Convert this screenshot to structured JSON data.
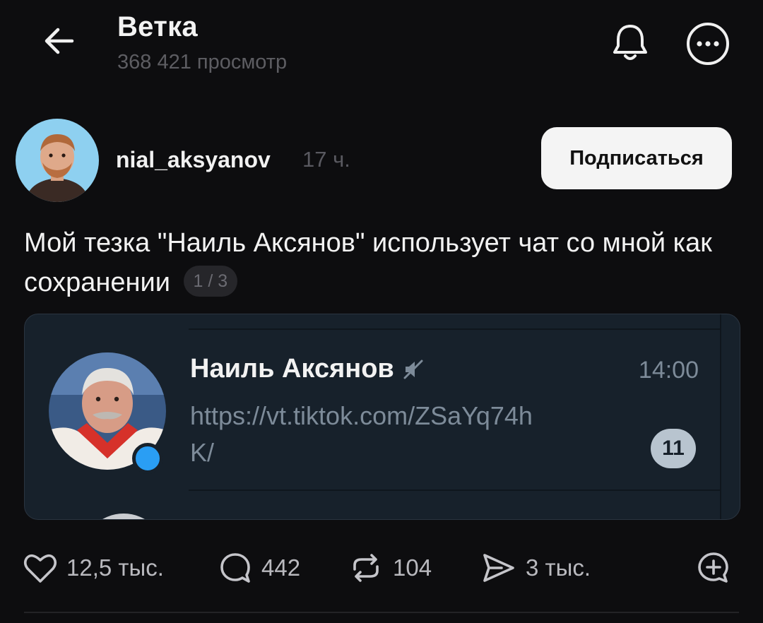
{
  "header": {
    "back_icon": "arrow-left-icon",
    "title": "Ветка",
    "views": "368 421 просмотр",
    "bell_icon": "bell-icon",
    "more_icon": "more-horizontal-icon"
  },
  "post": {
    "author": "nial_aksyanov",
    "time": "17 ч.",
    "subscribe_label": "Подписаться",
    "text": "Мой тезка \"Наиль Аксянов\" использует чат со мной как сохранении",
    "counter": "1 / 3"
  },
  "embedded_chat": {
    "name": "Наиль Аксянов",
    "muted_icon": "muted-speaker-icon",
    "time": "14:00",
    "message": "https://vt.tiktok.com/ZSaYq74hK/",
    "unread_count": "11",
    "colors": {
      "bg": "#17212b",
      "badge": "#b8c4cf",
      "online": "#2a9ef4"
    }
  },
  "actions": {
    "likes": "12,5 тыс.",
    "comments": "442",
    "reposts": "104",
    "shares": "3 тыс.",
    "icons": [
      "heart-icon",
      "comment-icon",
      "repost-icon",
      "send-icon",
      "add-reaction-icon"
    ]
  }
}
